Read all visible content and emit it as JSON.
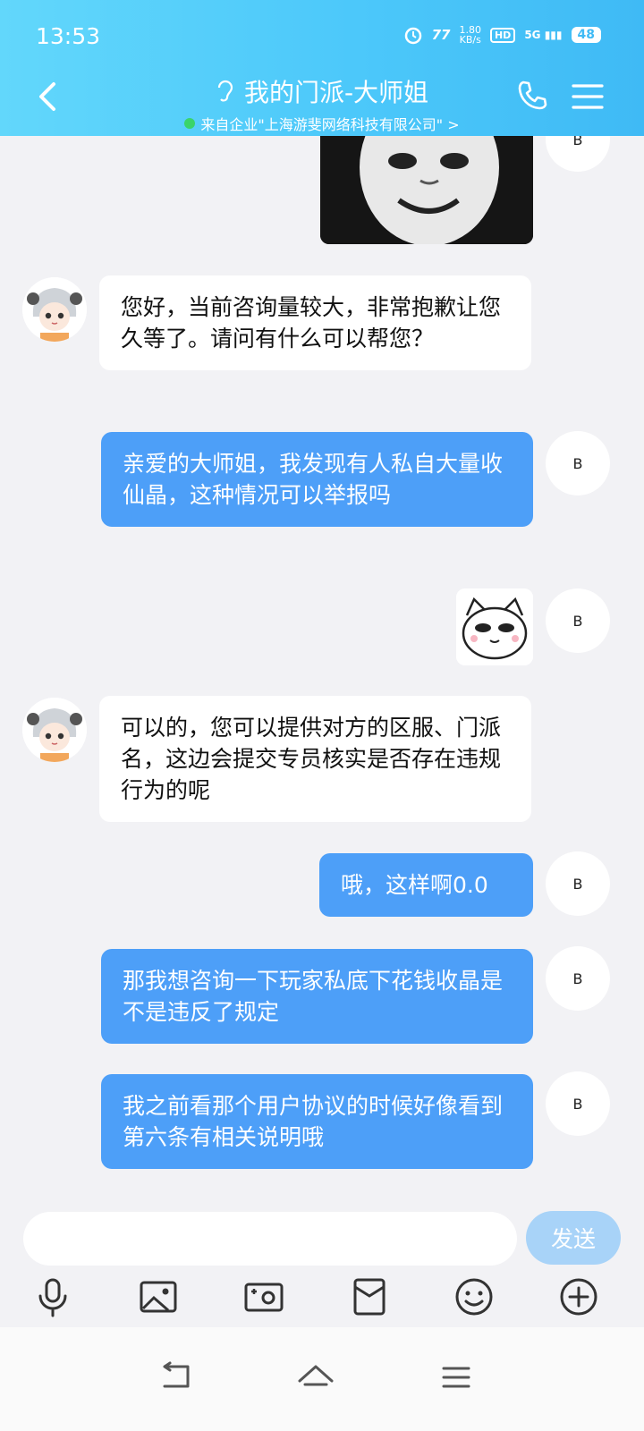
{
  "status_bar": {
    "time": "13:53",
    "speed_value": "1.80",
    "speed_unit": "KB/s",
    "hd": "HD",
    "network": "5G",
    "battery": "48"
  },
  "header": {
    "title": "我的门派-大师姐",
    "subtitle": "来自企业\"上海游斐网络科技有限公司\" >"
  },
  "avatars": {
    "user_label": "B"
  },
  "messages": [
    {
      "from": "agent",
      "text": "您好，当前咨询量较大，非常抱歉让您久等了。请问有什么可以帮您？"
    },
    {
      "from": "user",
      "text": "亲爱的大师姐，我发现有人私自大量收仙晶，这种情况可以举报吗"
    },
    {
      "from": "agent",
      "text": "可以的，您可以提供对方的区服、门派名，这边会提交专员核实是否存在违规行为的呢"
    },
    {
      "from": "user",
      "text": "哦，这样啊0.0"
    },
    {
      "from": "user",
      "text": "那我想咨询一下玩家私底下花钱收晶是不是违反了规定"
    },
    {
      "from": "user",
      "text": "我之前看那个用户协议的时候好像看到第六条有相关说明哦"
    }
  ],
  "input": {
    "placeholder": "",
    "send_label": "发送"
  },
  "colors": {
    "header": "#4cc8fa",
    "user_bubble": "#4d9ff8",
    "agent_bubble": "#ffffff",
    "send_button": "#a8d3f8"
  },
  "toolbar_icons": [
    "microphone-icon",
    "image-icon",
    "camera-icon",
    "red-packet-icon",
    "emoji-icon",
    "plus-icon"
  ],
  "nav_icons": [
    "back-nav-icon",
    "home-nav-icon",
    "recents-nav-icon"
  ]
}
